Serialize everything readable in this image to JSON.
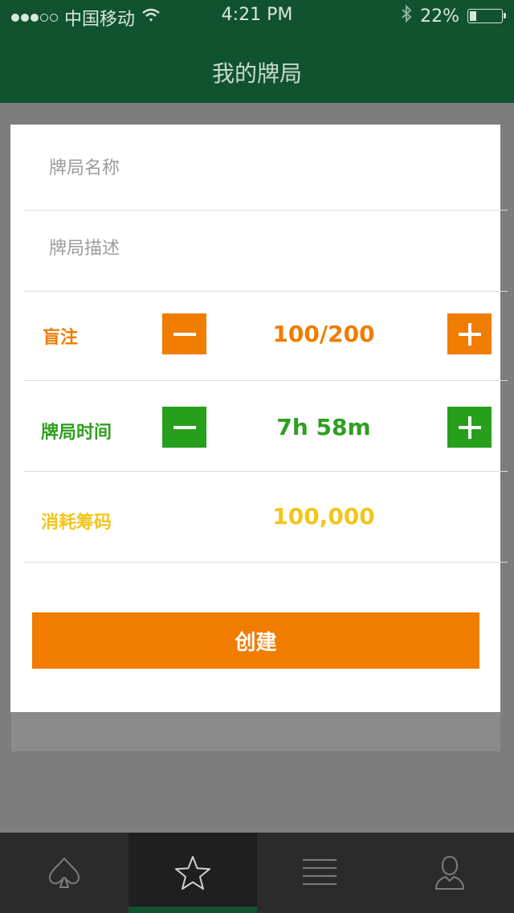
{
  "status_bar": {
    "carrier": "中国移动",
    "time": "4:21 PM",
    "battery_percent": "22%",
    "battery_level": 0.22,
    "signal_filled": 3,
    "signal_total": 5
  },
  "nav": {
    "title": "我的牌局"
  },
  "form": {
    "name_placeholder": "牌局名称",
    "description_placeholder": "牌局描述",
    "blinds_label": "盲注",
    "blinds_value": "100/200",
    "duration_label": "牌局时间",
    "duration_value": "7h 58m",
    "chips_label": "消耗筹码",
    "chips_value": "100,000",
    "create_label": "创建"
  },
  "tabs": [
    {
      "icon": "spade-icon",
      "active": false
    },
    {
      "icon": "star-icon",
      "active": true
    },
    {
      "icon": "menu-icon",
      "active": false
    },
    {
      "icon": "user-icon",
      "active": false
    }
  ],
  "colors": {
    "header": "#11532f",
    "orange": "#f07c00",
    "green": "#26a01c",
    "yellow": "#f3c51a"
  }
}
